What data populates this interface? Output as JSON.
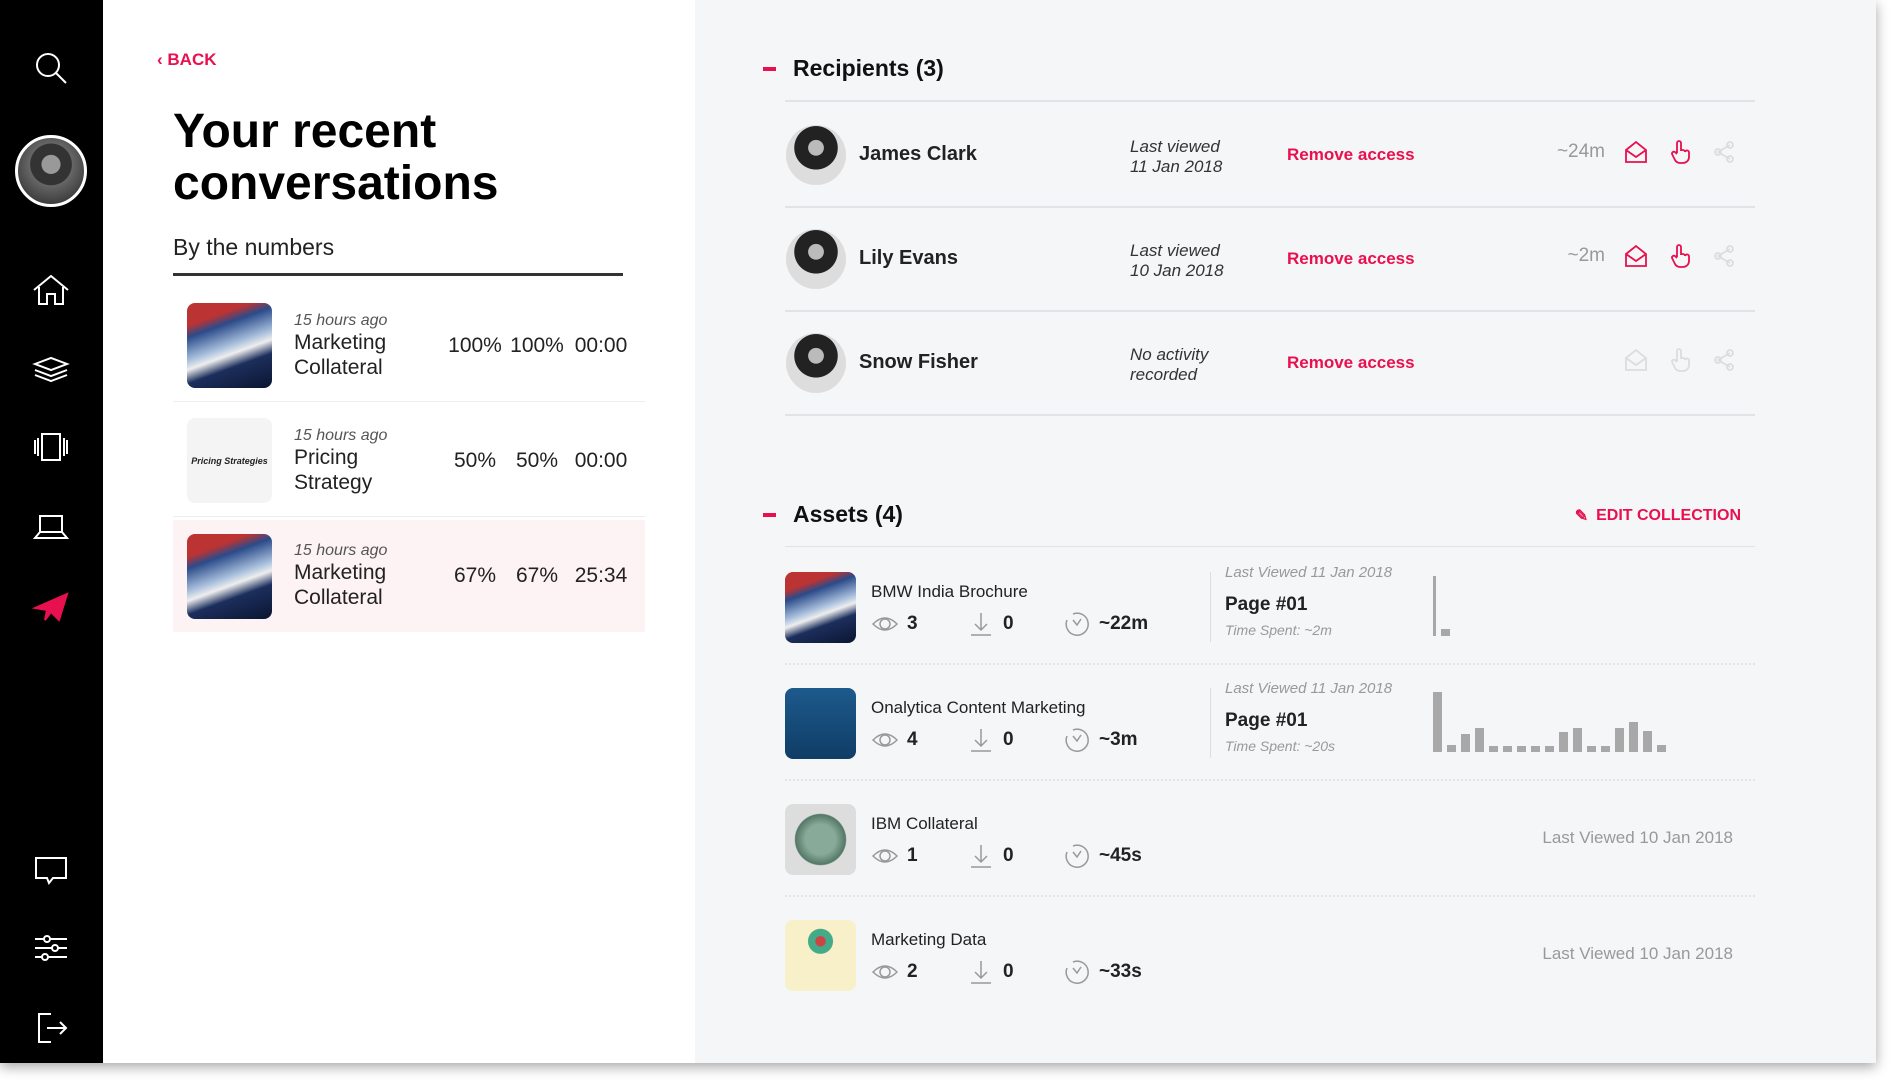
{
  "sidebar": {
    "items": [
      "search",
      "profile",
      "home",
      "layers",
      "carousel",
      "laptop",
      "send",
      "chat",
      "settings",
      "logout"
    ],
    "active": "send",
    "accent": "#e8104f"
  },
  "left": {
    "back_label": "BACK",
    "title_line1": "Your recent",
    "title_line2": "conversations",
    "subtitle": "By the numbers",
    "conversations": [
      {
        "ago": "15 hours ago",
        "name1": "Marketing",
        "name2": "Collateral",
        "s1": "100%",
        "s2": "100%",
        "s3": "00:00",
        "thumb": "car"
      },
      {
        "ago": "15 hours ago",
        "name1": "Pricing",
        "name2": "Strategy",
        "s1": "50%",
        "s2": "50%",
        "s3": "00:00",
        "thumb": "pricing",
        "thumb_text": "Pricing Strategies"
      },
      {
        "ago": "15 hours ago",
        "name1": "Marketing",
        "name2": "Collateral",
        "s1": "67%",
        "s2": "67%",
        "s3": "25:34",
        "thumb": "car",
        "selected": true
      }
    ]
  },
  "recipients": {
    "header": "Recipients (3)",
    "items": [
      {
        "name": "James Clark",
        "lv1": "Last viewed",
        "lv2": "11 Jan 2018",
        "remove": "Remove access",
        "time": "~24m",
        "active": true
      },
      {
        "name": "Lily Evans",
        "lv1": "Last viewed",
        "lv2": "10 Jan 2018",
        "remove": "Remove access",
        "time": "~2m",
        "active": true
      },
      {
        "name": "Snow Fisher",
        "lv1": "No activity",
        "lv2": "recorded",
        "remove": "Remove access",
        "time": "",
        "active": false
      }
    ]
  },
  "assets": {
    "header": "Assets (4)",
    "edit_label": "EDIT COLLECTION",
    "items": [
      {
        "name": "BMW India Brochure",
        "views": "3",
        "downloads": "0",
        "time": "~22m",
        "last_viewed": "Last Viewed 11 Jan 2018",
        "page": "Page #01",
        "time_spent": "Time Spent: ~2m",
        "page_times": [
          1.0,
          0.12
        ]
      },
      {
        "name": "Onalytica Content Marketing",
        "views": "4",
        "downloads": "0",
        "time": "~3m",
        "last_viewed": "Last Viewed 11 Jan 2018",
        "page": "Page #01",
        "time_spent": "Time Spent: ~20s",
        "page_times": [
          1.0,
          0.12,
          0.3,
          0.4,
          0.1,
          0.1,
          0.1,
          0.1,
          0.1,
          0.33,
          0.4,
          0.1,
          0.1,
          0.4,
          0.5,
          0.35,
          0.12
        ]
      },
      {
        "name": "IBM Collateral",
        "views": "1",
        "downloads": "0",
        "time": "~45s",
        "last_viewed": "Last Viewed 10 Jan 2018"
      },
      {
        "name": "Marketing Data",
        "views": "2",
        "downloads": "0",
        "time": "~33s",
        "last_viewed": "Last Viewed 10 Jan 2018"
      }
    ]
  }
}
